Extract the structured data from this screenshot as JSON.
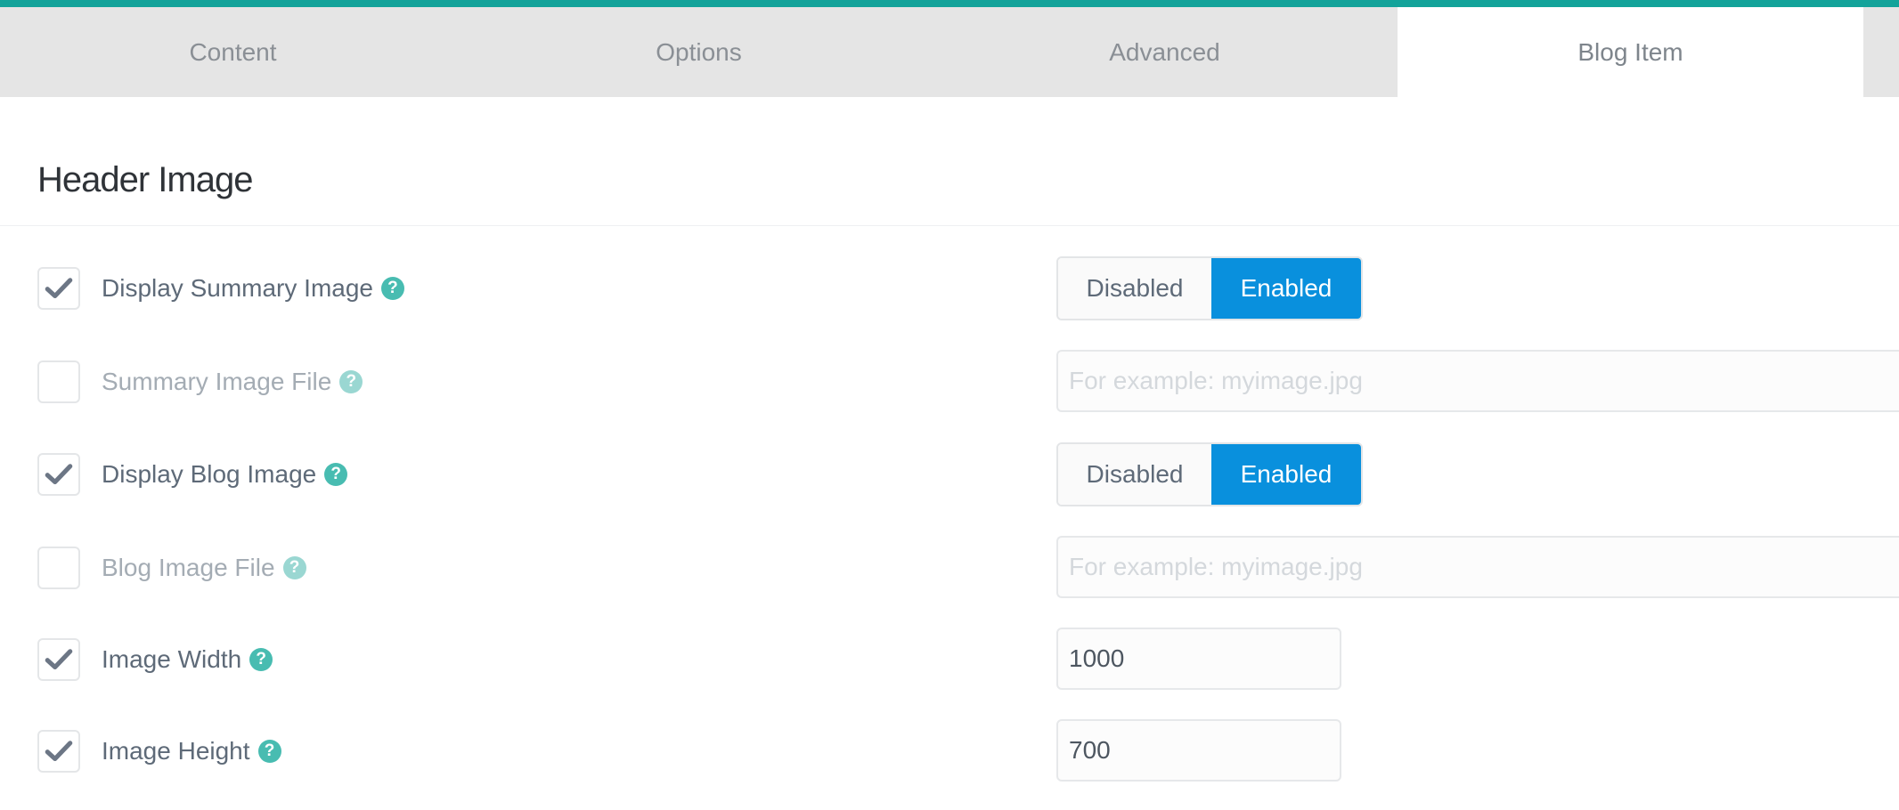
{
  "colors": {
    "accent": "#13a39a",
    "toggle_on": "#0990dd",
    "help": "#48bcb1"
  },
  "tabs": [
    {
      "label": "Content",
      "active": false
    },
    {
      "label": "Options",
      "active": false
    },
    {
      "label": "Advanced",
      "active": false
    },
    {
      "label": "Blog Item",
      "active": true
    }
  ],
  "section": {
    "title": "Header Image"
  },
  "toggle_labels": {
    "disabled": "Disabled",
    "enabled": "Enabled"
  },
  "rows": [
    {
      "label": "Display Summary Image",
      "checked": true,
      "control": "toggle",
      "selected": "Enabled"
    },
    {
      "label": "Summary Image File",
      "checked": false,
      "control": "text",
      "value": "",
      "placeholder": "For example: myimage.jpg"
    },
    {
      "label": "Display Blog Image",
      "checked": true,
      "control": "toggle",
      "selected": "Enabled"
    },
    {
      "label": "Blog Image File",
      "checked": false,
      "control": "text",
      "value": "",
      "placeholder": "For example: myimage.jpg"
    },
    {
      "label": "Image Width",
      "checked": true,
      "control": "number",
      "value": "1000"
    },
    {
      "label": "Image Height",
      "checked": true,
      "control": "number",
      "value": "700"
    }
  ],
  "icons": {
    "check": "checkmark-icon",
    "help": "question-circle-icon"
  }
}
